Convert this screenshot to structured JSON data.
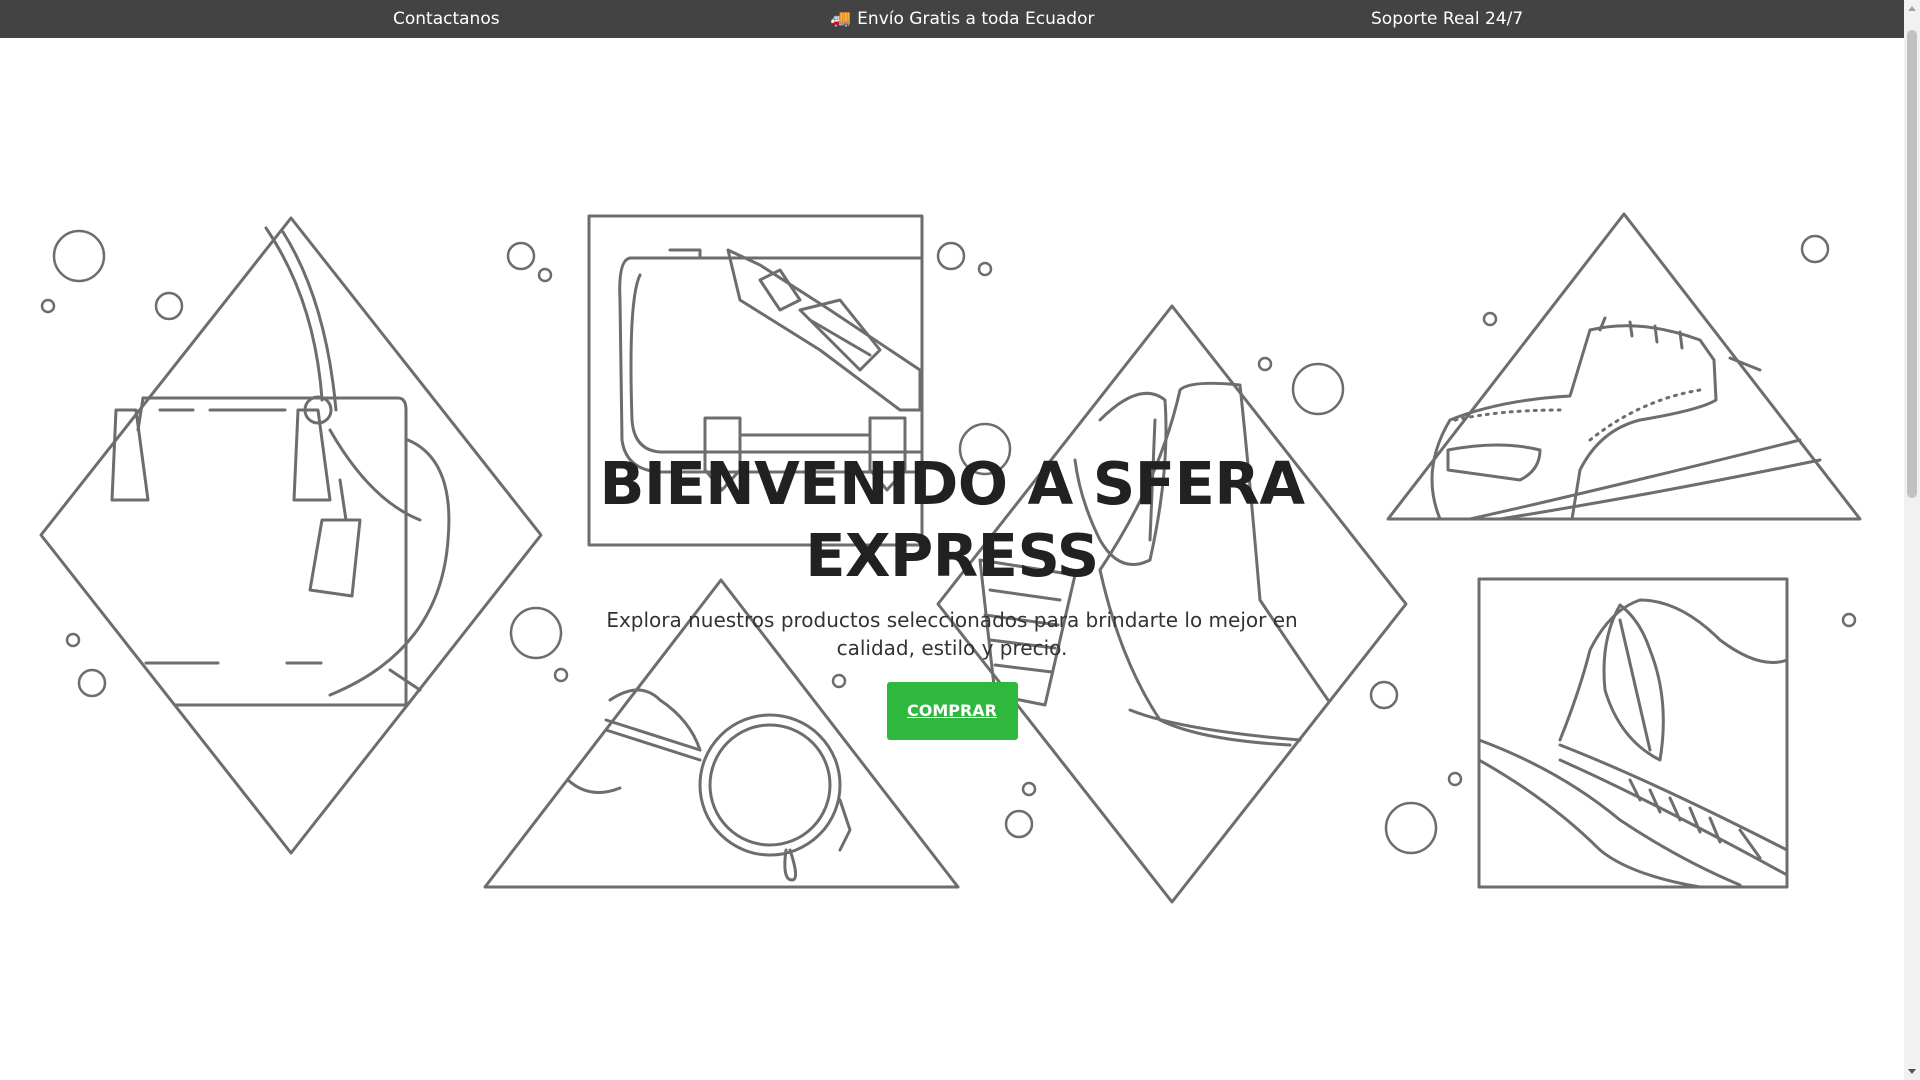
{
  "topbar": {
    "contact": "Contactanos",
    "shipping": "Envío Gratis a toda Ecuador",
    "support": "Soporte Real 24/7"
  },
  "hero": {
    "title": "BIENVENIDO A SFERA EXPRESS",
    "subtitle": "Explora nuestros productos seleccionados para brindarte lo mejor en calidad, estilo y precio.",
    "cta": "COMPRAR"
  },
  "colors": {
    "topbar_bg": "#434343",
    "cta_bg": "#2eb83e",
    "line_art": "#6d6d6d"
  },
  "icons": [
    "truck-icon"
  ]
}
